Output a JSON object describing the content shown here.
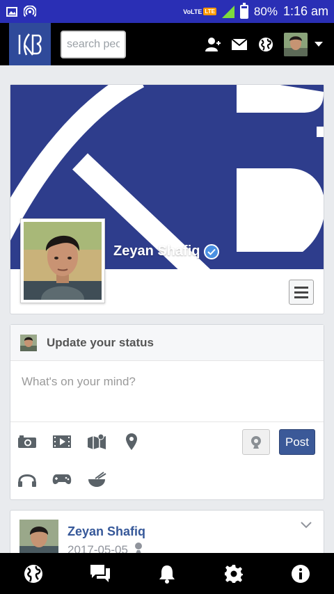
{
  "status_bar": {
    "network_label": "VoLTE",
    "lte_badge": "LTE",
    "battery": "80%",
    "time": "1:16 am"
  },
  "header": {
    "search": {
      "placeholder": "search people"
    }
  },
  "profile": {
    "name": "Zeyan Shafiq"
  },
  "composer": {
    "title": "Update your status",
    "placeholder": "What's on your mind?",
    "post_label": "Post"
  },
  "post": {
    "author": "Zeyan Shafiq",
    "date": "2017-05-05"
  },
  "colors": {
    "statusbar": "#2a2fb5",
    "brand": "#2e3d8c",
    "link": "#365899",
    "post_button": "#3b5998"
  },
  "icons": {
    "header": [
      "add-friend-icon",
      "mail-icon",
      "globe-icon"
    ],
    "composer_row1": [
      "camera-icon",
      "video-icon",
      "map-icon",
      "location-pin-icon"
    ],
    "composer_row2": [
      "headphones-icon",
      "gamepad-icon",
      "food-bowl-icon"
    ],
    "bottom_nav": [
      "globe-icon",
      "chat-icon",
      "bell-icon",
      "gear-icon",
      "info-icon"
    ]
  }
}
